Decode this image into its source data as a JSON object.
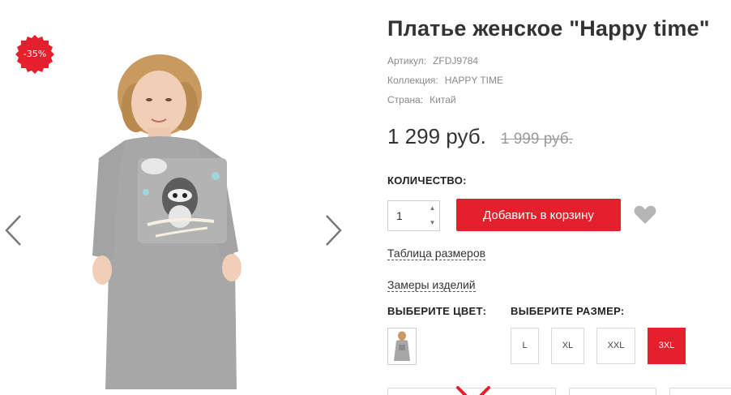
{
  "badge": {
    "discount": "-35%",
    "color": "#e3202b"
  },
  "product": {
    "title": "Платье женское \"Happy time\"",
    "meta": [
      {
        "label": "Артикул:",
        "value": "ZFDJ9784"
      },
      {
        "label": "Коллекция:",
        "value": "HAPPY TIME"
      },
      {
        "label": "Страна:",
        "value": "Китай"
      }
    ],
    "price": "1 299 руб.",
    "old_price": "1 999 руб."
  },
  "quantity": {
    "label": "КОЛИЧЕСТВО:",
    "value": "1"
  },
  "cart": {
    "add_label": "Добавить в корзину",
    "accent": "#e3202b"
  },
  "links": {
    "size_table": "Таблица размеров",
    "measurements": "Замеры изделий"
  },
  "color_section": {
    "label": "ВЫБЕРИТЕ ЦВЕТ:"
  },
  "size_section": {
    "label": "ВЫБЕРИТЕ РАЗМЕР:",
    "sizes": [
      "L",
      "XL",
      "XXL",
      "3XL"
    ],
    "selected": "3XL"
  },
  "icons": {
    "prev": "chevron-left-icon",
    "next": "chevron-right-icon",
    "wishlist": "heart-icon",
    "quantity_up": "triangle-up-icon",
    "quantity_down": "triangle-down-icon"
  }
}
